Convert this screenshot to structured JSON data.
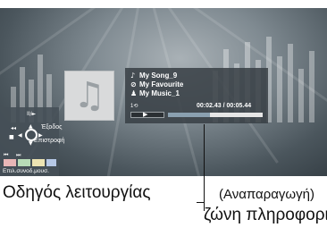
{
  "heading_fragment": "Μουσική ζώνη πληροφοριών",
  "info": {
    "song": "My Song_9",
    "favourite": "My Favourite",
    "artist": "My Music_1",
    "counter": "1⟲",
    "time": "00:02.43 / 00:05.44",
    "progress": 0.44,
    "song_icon": "music-note-icon",
    "favourite_icon": "link-icon",
    "artist_icon": "person-icon"
  },
  "guide": {
    "play_pause_symbol": "II/►",
    "exit_label": "Έξοδος",
    "return_label": "Επιστροφή",
    "repeat_label": "Επιλ.συνοδ.μουσ.",
    "prev_symbol": "⏮",
    "next_symbol": "⏭"
  },
  "captions": {
    "guide_caption": "Οδηγός λειτουργίας",
    "playback_caption": "(Αναπαραγωγή)",
    "info_zone_caption": "ζώνη πληροφοριών"
  }
}
